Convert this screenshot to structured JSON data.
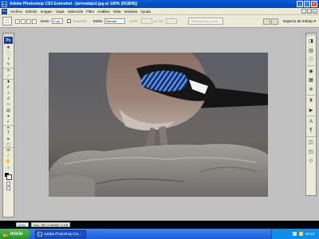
{
  "titlebar": {
    "title": "Adobe Photoshop CS3 Extended - [arrendajo2.jpg al 100% (RGB/8)]"
  },
  "menu": {
    "items": [
      "Archivo",
      "Edición",
      "Imagen",
      "Capa",
      "Selección",
      "Filtro",
      "Análisis",
      "Vista",
      "Ventana",
      "Ayuda"
    ]
  },
  "options": {
    "feather_label": "Desv.:",
    "feather_value": "0 px",
    "smooth_label": "Suavizar",
    "style_label": "Estilo:",
    "style_value": "Normal",
    "width_label": "Anch.:",
    "height_label": "Alt.:",
    "refine_label": "Perfeccionar borde...",
    "workspace_label": "Espacio de trabajo ▾"
  },
  "status": {
    "zoom": "100%",
    "doc": "Doc: 957,4 KB/957,4 KB"
  },
  "taskbar": {
    "start_label": "Inicio",
    "task_label": "Adobe Photoshop CS...",
    "clock": "20:12"
  },
  "toolbox": {
    "tools": [
      "move-tool",
      "marquee-tool",
      "lasso-tool",
      "quick-selection-tool",
      "crop-tool",
      "slice-tool",
      "healing-brush-tool",
      "brush-tool",
      "clone-stamp-tool",
      "history-brush-tool",
      "eraser-tool",
      "gradient-tool",
      "blur-tool",
      "dodge-tool",
      "pen-tool",
      "type-tool",
      "path-selection-tool",
      "rectangle-tool",
      "notes-tool",
      "eyedropper-tool",
      "hand-tool",
      "zoom-tool"
    ]
  },
  "colors": {
    "foreground": "#000000",
    "background": "#ffffff",
    "titlebar": "#0a5bd8",
    "workspace": "#c0c0c0"
  }
}
